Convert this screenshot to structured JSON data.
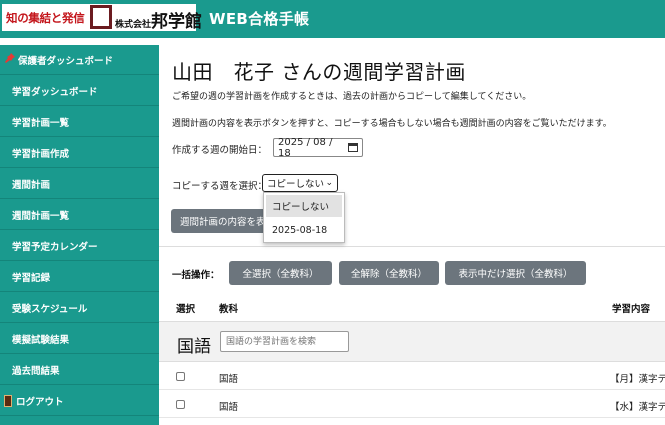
{
  "header": {
    "logo_slogan": "知の集結と発信",
    "logo_company_prefix": "株式会社",
    "logo_company_name": "邦学館",
    "app_title": "WEB合格手帳"
  },
  "sidebar": {
    "items": [
      {
        "label": "保護者ダッシュボード",
        "icon": "pin-icon"
      },
      {
        "label": "学習ダッシュボード"
      },
      {
        "label": "学習計画一覧"
      },
      {
        "label": "学習計画作成"
      },
      {
        "label": "週間計画"
      },
      {
        "label": "週間計画一覧"
      },
      {
        "label": "学習予定カレンダー"
      },
      {
        "label": "学習記録"
      },
      {
        "label": "受験スケジュール"
      },
      {
        "label": "模擬試験結果"
      },
      {
        "label": "過去問結果"
      },
      {
        "label": "ログアウト",
        "icon": "door-icon"
      }
    ]
  },
  "main": {
    "title": "山田　花子 さんの週間学習計画",
    "desc1": "ご希望の週の学習計画を作成するときは、過去の計画からコピーして編集してください。",
    "desc2": "週間計画の内容を表示ボタンを押すと、コピーする場合もしない場合も週間計画の内容をご覧いただけます。",
    "start_label": "作成する週の開始日：",
    "start_date": "2025 / 08 / 18",
    "copy_label": "コピーする週を選択：",
    "copy_selected": "コピーしない",
    "copy_options": [
      "コピーしない",
      "2025-08-18"
    ],
    "show_button": "週間計画の内容を表示",
    "bulk_label": "一括操作：",
    "bulk_buttons": [
      "全選択（全教科）",
      "全解除（全教科）",
      "表示中だけ選択（全教科）"
    ],
    "table": {
      "headers": [
        "選択",
        "教科",
        "学習内容"
      ],
      "subject_group": "国語",
      "search_placeholder": "国語の学習計画を検索",
      "rows": [
        {
          "subject": "国語",
          "content": "【月】漢字テ"
        },
        {
          "subject": "国語",
          "content": "【水】漢字テ"
        }
      ]
    }
  },
  "colors": {
    "brand_teal": "#1a9a8e",
    "button_gray": "#6c757d",
    "logo_red": "#c4161c"
  }
}
